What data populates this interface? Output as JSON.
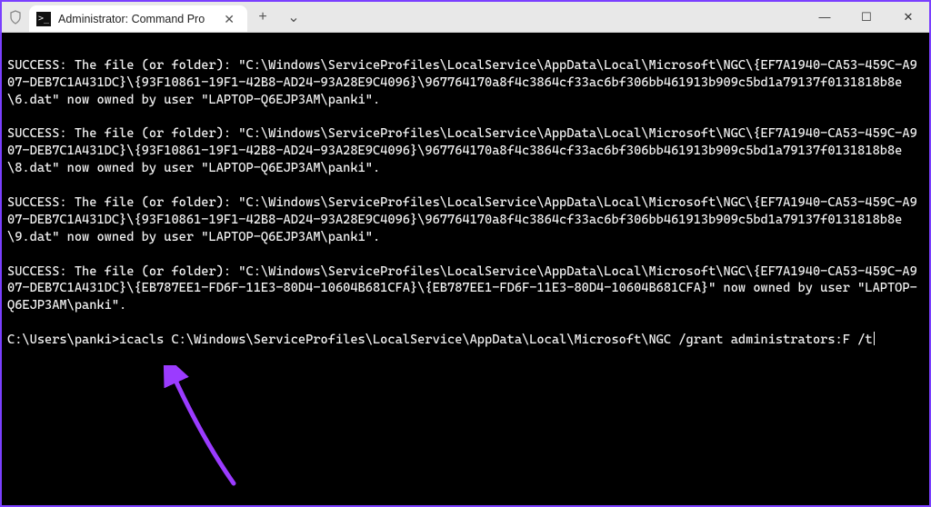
{
  "titlebar": {
    "tab_title": "Administrator: Command Pro",
    "tab_icon_glyph": ">_",
    "new_tab_glyph": "+",
    "tab_menu_glyph": "⌄",
    "minimize_glyph": "—",
    "maximize_glyph": "☐",
    "close_glyph": "✕",
    "tab_close_glyph": "✕"
  },
  "terminal": {
    "blocks": [
      "SUCCESS: The file (or folder): \"C:\\Windows\\ServiceProfiles\\LocalService\\AppData\\Local\\Microsoft\\NGC\\{EF7A1940-CA53-459C-A907-DEB7C1A431DC}\\{93F10861-19F1-42B8-AD24-93A28E9C4096}\\967764170a8f4c3864cf33ac6bf306bb461913b909c5bd1a79137f0131818b8e\\6.dat\" now owned by user \"LAPTOP-Q6EJP3AM\\panki\".",
      "SUCCESS: The file (or folder): \"C:\\Windows\\ServiceProfiles\\LocalService\\AppData\\Local\\Microsoft\\NGC\\{EF7A1940-CA53-459C-A907-DEB7C1A431DC}\\{93F10861-19F1-42B8-AD24-93A28E9C4096}\\967764170a8f4c3864cf33ac6bf306bb461913b909c5bd1a79137f0131818b8e\\8.dat\" now owned by user \"LAPTOP-Q6EJP3AM\\panki\".",
      "SUCCESS: The file (or folder): \"C:\\Windows\\ServiceProfiles\\LocalService\\AppData\\Local\\Microsoft\\NGC\\{EF7A1940-CA53-459C-A907-DEB7C1A431DC}\\{93F10861-19F1-42B8-AD24-93A28E9C4096}\\967764170a8f4c3864cf33ac6bf306bb461913b909c5bd1a79137f0131818b8e\\9.dat\" now owned by user \"LAPTOP-Q6EJP3AM\\panki\".",
      "SUCCESS: The file (or folder): \"C:\\Windows\\ServiceProfiles\\LocalService\\AppData\\Local\\Microsoft\\NGC\\{EF7A1940-CA53-459C-A907-DEB7C1A431DC}\\{EB787EE1-FD6F-11E3-80D4-10604B681CFA}\\{EB787EE1-FD6F-11E3-80D4-10604B681CFA}\" now owned by user \"LAPTOP-Q6EJP3AM\\panki\"."
    ],
    "prompt": "C:\\Users\\panki>",
    "command": "icacls C:\\Windows\\ServiceProfiles\\LocalService\\AppData\\Local\\Microsoft\\NGC /grant administrators:F /t"
  },
  "annotation": {
    "arrow_color": "#9b3bff"
  }
}
